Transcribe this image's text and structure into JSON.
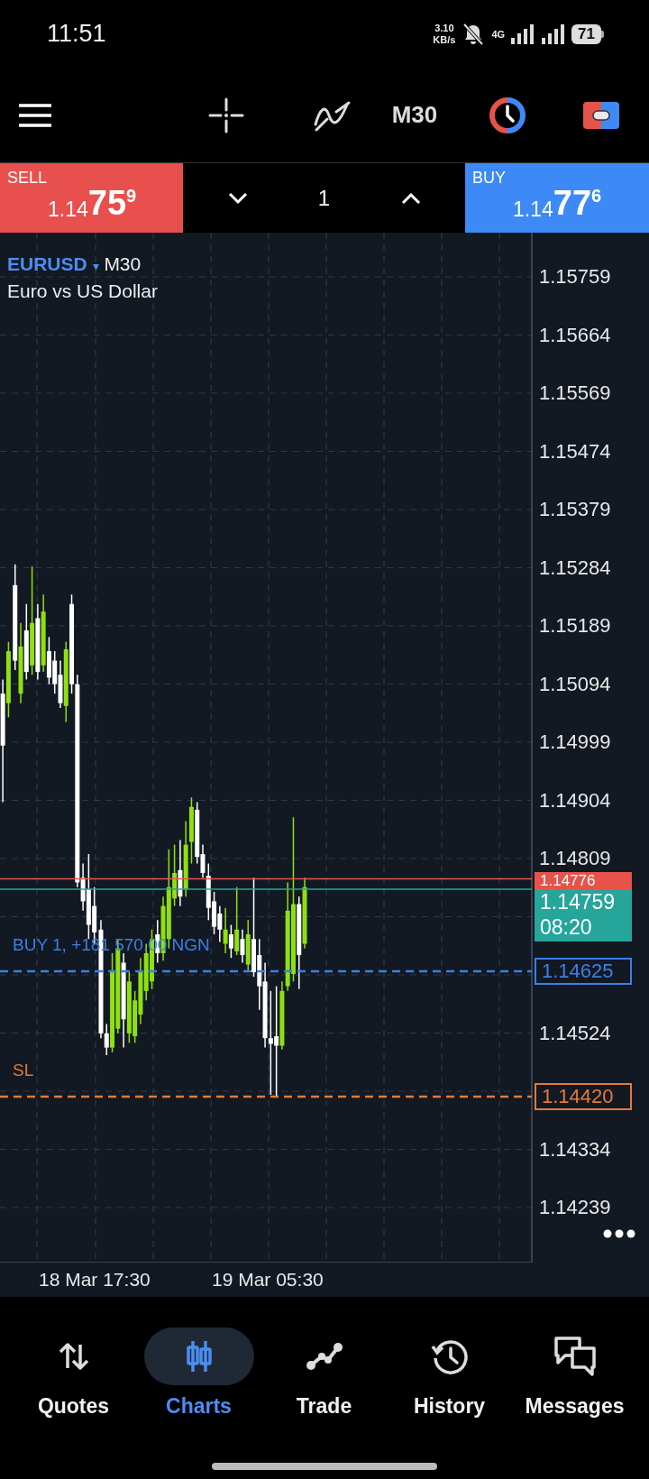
{
  "status_bar": {
    "time": "11:51",
    "net_speed": "3.10",
    "net_unit": "KB/s",
    "network": "4G",
    "battery": "71"
  },
  "toolbar": {
    "timeframe": "M30"
  },
  "trade_bar": {
    "sell": {
      "label": "SELL",
      "price_prefix": "1.14",
      "price_main": "75",
      "price_sup": "9"
    },
    "volume": "1",
    "buy": {
      "label": "BUY",
      "price_prefix": "1.14",
      "price_main": "77",
      "price_sup": "6"
    }
  },
  "chart": {
    "symbol": "EURUSD",
    "dropdown": "▾",
    "timeframe": "M30",
    "description": "Euro vs US Dollar",
    "y_ticks": [
      "1.15759",
      "1.15664",
      "1.15569",
      "1.15474",
      "1.15379",
      "1.15284",
      "1.15189",
      "1.15094",
      "1.14999",
      "1.14904",
      "1.14809",
      "1.14524",
      "1.14334",
      "1.14239"
    ],
    "price_lines": [
      {
        "kind": "ask",
        "price": "1.14776",
        "color": "#e5534b"
      },
      {
        "kind": "bid",
        "price": "1.14759",
        "countdown": "08:20",
        "color": "#26a69a"
      },
      {
        "kind": "order",
        "price": "1.14625",
        "label": "BUY 1, +181 570.00 NGN",
        "color": "#3d7fe6"
      },
      {
        "kind": "stop",
        "price": "1.14420",
        "label": "SL",
        "color": "#e27b36"
      }
    ],
    "x_labels": [
      "18 Mar 17:30",
      "19 Mar 05:30"
    ]
  },
  "nav": [
    {
      "label": "Quotes",
      "selected": false
    },
    {
      "label": "Charts",
      "selected": true
    },
    {
      "label": "Trade",
      "selected": false
    },
    {
      "label": "History",
      "selected": false
    },
    {
      "label": "Messages",
      "selected": false
    }
  ]
}
